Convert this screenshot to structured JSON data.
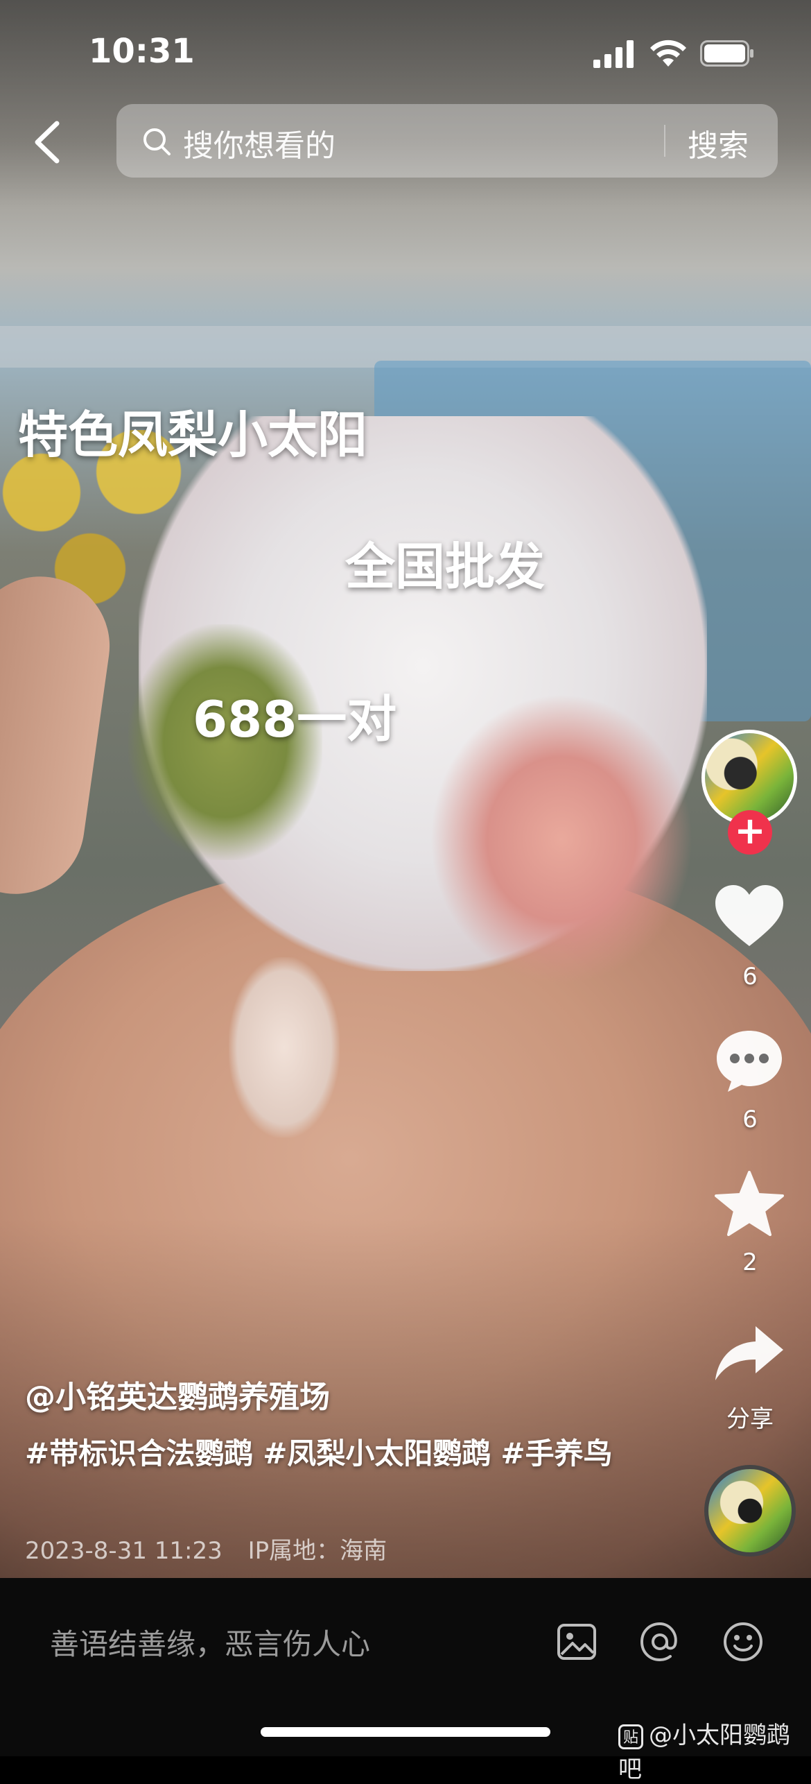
{
  "status_bar": {
    "time": "10:31"
  },
  "search": {
    "placeholder": "搜你想看的",
    "button_label": "搜索"
  },
  "video": {
    "captions": [
      "特色凤梨小太阳",
      "全国批发",
      "688一对"
    ]
  },
  "actions": {
    "follow_symbol": "+",
    "like_count": "6",
    "comment_count": "6",
    "favorite_count": "2",
    "share_label": "分享"
  },
  "post": {
    "author": "@小铭英达鹦鹉养殖场",
    "tags": [
      "#带标识合法鹦鹉",
      "#凤梨小太阳鹦鹉",
      "#手养鸟"
    ],
    "date": "2023-8-31 11:23",
    "ip_location": "IP属地：海南"
  },
  "comment_bar": {
    "placeholder": "善语结善缘，恶言伤人心"
  },
  "watermark": {
    "logo_text": "贴",
    "text": "@小太阳鹦鹉吧"
  },
  "colors": {
    "follow_red": "#f0324c",
    "comment_bar_bg": "#0b0b0b"
  }
}
